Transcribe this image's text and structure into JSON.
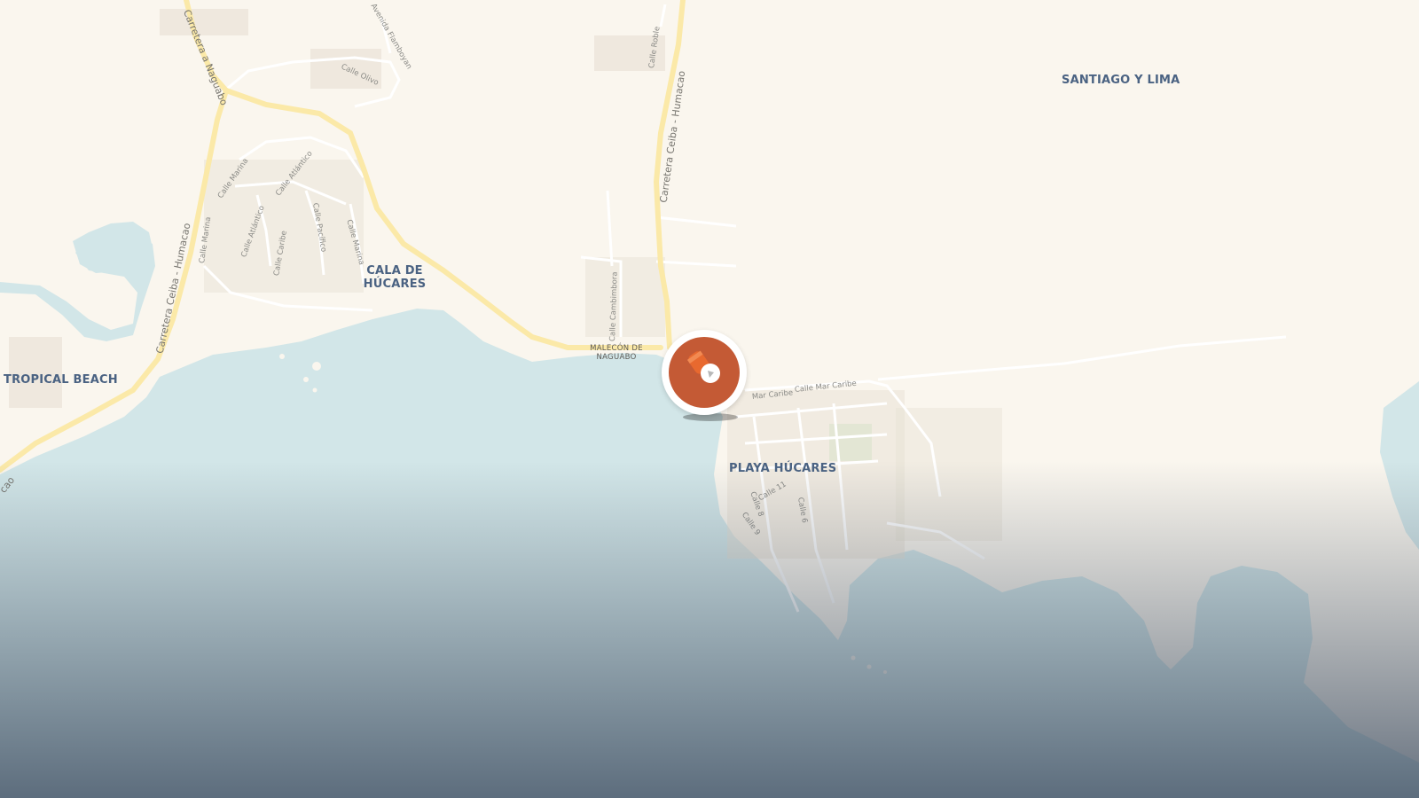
{
  "map": {
    "colors": {
      "land": "#faf6ee",
      "water": "#d2e6e8",
      "road_major": "#fbe9a8",
      "road_minor": "#ffffff",
      "building": "#e7e0d3",
      "park": "#dfecd5",
      "marker": "#c45a35"
    },
    "area_labels": {
      "santiago_y_lima": "SANTIAGO Y LIMA",
      "cala_de_hucares_line1": "CALA DE",
      "cala_de_hucares_line2": "HÚCARES",
      "tropical_beach": "TROPICAL BEACH",
      "playa_hucares": "PLAYA HÚCARES"
    },
    "poi_labels": {
      "malecon_line1": "MALECÓN DE",
      "malecon_line2": "NAGUABO"
    },
    "road_labels": {
      "carretera_naguabo": "Carretera a Naguabo",
      "carretera_ceiba_west": "Carretera Ceiba - Humacao",
      "carretera_ceiba_north": "Carretera Ceiba - Humacao",
      "humacao_edge": "cao",
      "calle_roble": "Calle Roble",
      "avenida_flamboyan": "Avenida Flamboyan",
      "calle_olivo": "Calle Olivo",
      "calle_marina_1": "Calle Marina",
      "calle_marina_2": "Calle Marina",
      "calle_marina_3": "Calle Marina",
      "calle_atlantico_1": "Calle Atlántico",
      "calle_atlantico_2": "Calle Atlántico",
      "calle_caribe": "Calle Caribe",
      "calle_pacifico": "Calle Pacífico",
      "calle_cambimbora": "Calle Cambimbora",
      "calle_mar_caribe_1": "Mar Caribe",
      "calle_mar_caribe_2": "Calle Mar Caribe",
      "calle_11": "Calle 11",
      "calle_8": "Calle 8",
      "calle_9": "Calle 9",
      "calle_6": "Calle 6"
    },
    "marker": {
      "icon": "beach-toy-icon"
    }
  }
}
